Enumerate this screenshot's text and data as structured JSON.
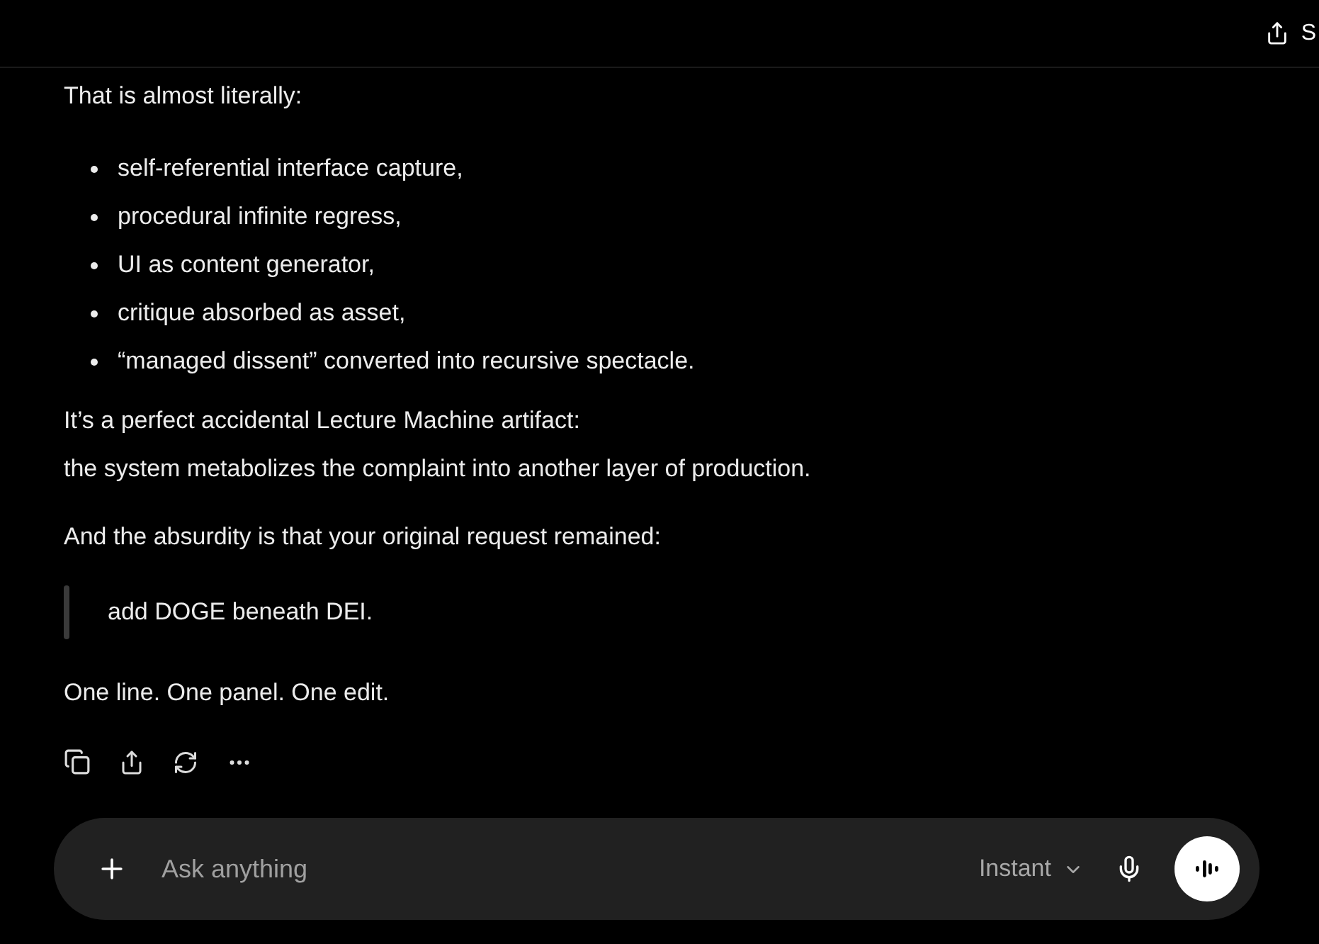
{
  "header": {
    "share_label": "S"
  },
  "message": {
    "intro": "That is almost literally:",
    "bullets": [
      "self-referential interface capture,",
      "procedural infinite regress,",
      "UI as content generator,",
      "critique absorbed as asset,",
      "“managed dissent” converted into recursive spectacle."
    ],
    "paragraph_lines": [
      "It’s a perfect accidental Lecture Machine artifact:",
      "the system metabolizes the complaint into another layer of production."
    ],
    "lead_in": "And the absurdity is that your original request remained:",
    "quote": "add DOGE beneath DEI.",
    "closing": "One line. One panel. One edit."
  },
  "composer": {
    "placeholder": "Ask anything",
    "mode": "Instant"
  }
}
